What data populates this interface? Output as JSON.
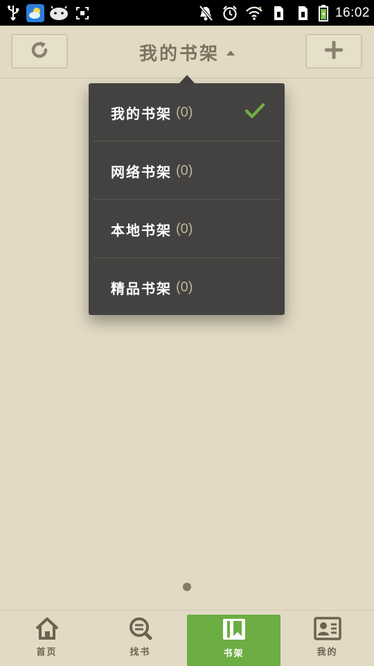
{
  "status_bar": {
    "time": "16:02"
  },
  "header": {
    "title": "我的书架"
  },
  "dropdown": {
    "items": [
      {
        "label": "我的书架",
        "count": "(0)",
        "selected": true
      },
      {
        "label": "网络书架",
        "count": "(0)",
        "selected": false
      },
      {
        "label": "本地书架",
        "count": "(0)",
        "selected": false
      },
      {
        "label": "精品书架",
        "count": "(0)",
        "selected": false
      }
    ]
  },
  "bottom_nav": {
    "tabs": [
      {
        "label": "首页",
        "icon": "home-icon",
        "active": false
      },
      {
        "label": "找书",
        "icon": "search-icon",
        "active": false
      },
      {
        "label": "书架",
        "icon": "bookshelf-icon",
        "active": true
      },
      {
        "label": "我的",
        "icon": "profile-card-icon",
        "active": false
      }
    ]
  },
  "colors": {
    "background": "#e2dac4",
    "dropdown_bg": "#434240",
    "accent_green": "#6cad44",
    "title_brown": "#7d7260"
  }
}
